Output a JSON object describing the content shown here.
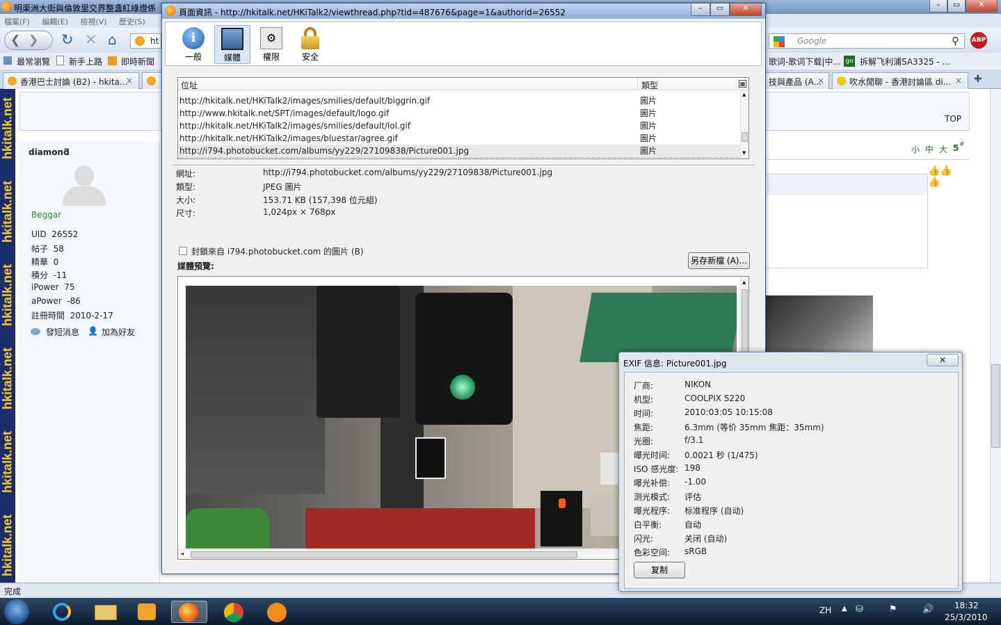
{
  "browser": {
    "title": "明渠洲大街與倫敦里交界整盞紅綠燈係",
    "menu": [
      "檔案(F)",
      "編輯(E)",
      "檢視(V)",
      "歷史(S)"
    ],
    "url_fragment": "ht",
    "search_placeholder": "Google",
    "abp_label": "ABP",
    "bookmarks": [
      "最常瀏覽",
      "新手上路",
      "即時新聞"
    ],
    "bookmarks_right": [
      "歌词-歌词下载|中...",
      "拆解飞利浦SA3325 - ..."
    ],
    "bookmarks_right_badge": "go",
    "tabs": [
      "香港巴士討論 (B2) - hkita...",
      "技與產品 (A...",
      "吹水閒聊 - 香港討論區 di..."
    ],
    "brand_text": "hkitalk.net",
    "top_link": "TOP",
    "size_links": [
      "小",
      "中",
      "大"
    ],
    "post_number": "5",
    "post_number_sup": "#",
    "status": "完成"
  },
  "user": {
    "name": "diamond",
    "rank": "Beggar",
    "fields": [
      {
        "k": "UID",
        "v": "26552"
      },
      {
        "k": "帖子",
        "v": "58"
      },
      {
        "k": "精華",
        "v": "0"
      },
      {
        "k": "積分",
        "v": "-11"
      },
      {
        "k": "iPower",
        "v": "75"
      },
      {
        "k": "aPower",
        "v": "-86"
      },
      {
        "k": "註冊時間",
        "v": "2010-2-17"
      }
    ],
    "send_msg": "發短消息",
    "add_friend": "加為好友"
  },
  "dialog": {
    "title": "頁面資訊 - http://hkitalk.net/HKiTalk2/viewthread.php?tid=487676&page=1&authorid=26552",
    "toolbar": [
      {
        "label": "一般",
        "icon": "info-icon"
      },
      {
        "label": "媒體",
        "icon": "media-icon"
      },
      {
        "label": "權限",
        "icon": "permissions-icon"
      },
      {
        "label": "安全",
        "icon": "lock-icon"
      }
    ],
    "columns": {
      "address": "位址",
      "type": "類型"
    },
    "rows": [
      {
        "url": "http://hkitalk.net/HKiTalk2/images/smilies/default/biggrin.gif",
        "type": "圖片"
      },
      {
        "url": "http://www.hkitalk.net/SPT/images/default/logo.gif",
        "type": "圖片"
      },
      {
        "url": "http://hkitalk.net/HKiTalk2/images/smilies/default/lol.gif",
        "type": "圖片"
      },
      {
        "url": "http://hkitalk.net/HKiTalk2/images/bluestar/agree.gif",
        "type": "圖片"
      },
      {
        "url": "http://i794.photobucket.com/albums/yy229/27109838/Picture001.jpg",
        "type": "圖片"
      }
    ],
    "details": [
      {
        "k": "網址:",
        "v": "http://i794.photobucket.com/albums/yy229/27109838/Picture001.jpg"
      },
      {
        "k": "類型:",
        "v": "JPEG 圖片"
      },
      {
        "k": "大小:",
        "v": "153.71 KB (157,398 位元組)"
      },
      {
        "k": "尺寸:",
        "v": "1,024px × 768px"
      }
    ],
    "block_label": "封鎖來自 i794.photobucket.com 的圖片 (B)",
    "save_as": "另存新檔 (A)...",
    "preview_label": "媒體預覽:"
  },
  "exif": {
    "title": "EXIF 信息: Picture001.jpg",
    "rows": [
      {
        "k": "厂商:",
        "v": "NIKON"
      },
      {
        "k": "机型:",
        "v": "COOLPIX S220"
      },
      {
        "k": "时间:",
        "v": "2010:03:05 10:15:08"
      },
      {
        "k": "焦距:",
        "v": "6.3mm (等价 35mm 焦距：35mm)"
      },
      {
        "k": "光圈:",
        "v": "f/3.1"
      },
      {
        "k": "曝光时间:",
        "v": "0.0021 秒 (1/475)"
      },
      {
        "k": "ISO 感光度:",
        "v": "198"
      },
      {
        "k": "曝光补偿:",
        "v": "-1.00"
      },
      {
        "k": "测光模式:",
        "v": "评估"
      },
      {
        "k": "曝光程序:",
        "v": "标准程序 (自动)"
      },
      {
        "k": "白平衡:",
        "v": "自动"
      },
      {
        "k": "闪光:",
        "v": "关闭 (自动)"
      },
      {
        "k": "色彩空间:",
        "v": "sRGB"
      }
    ],
    "copy": "复制"
  },
  "taskbar": {
    "lang": "ZH",
    "time": "18:32",
    "date": "25/3/2010"
  }
}
